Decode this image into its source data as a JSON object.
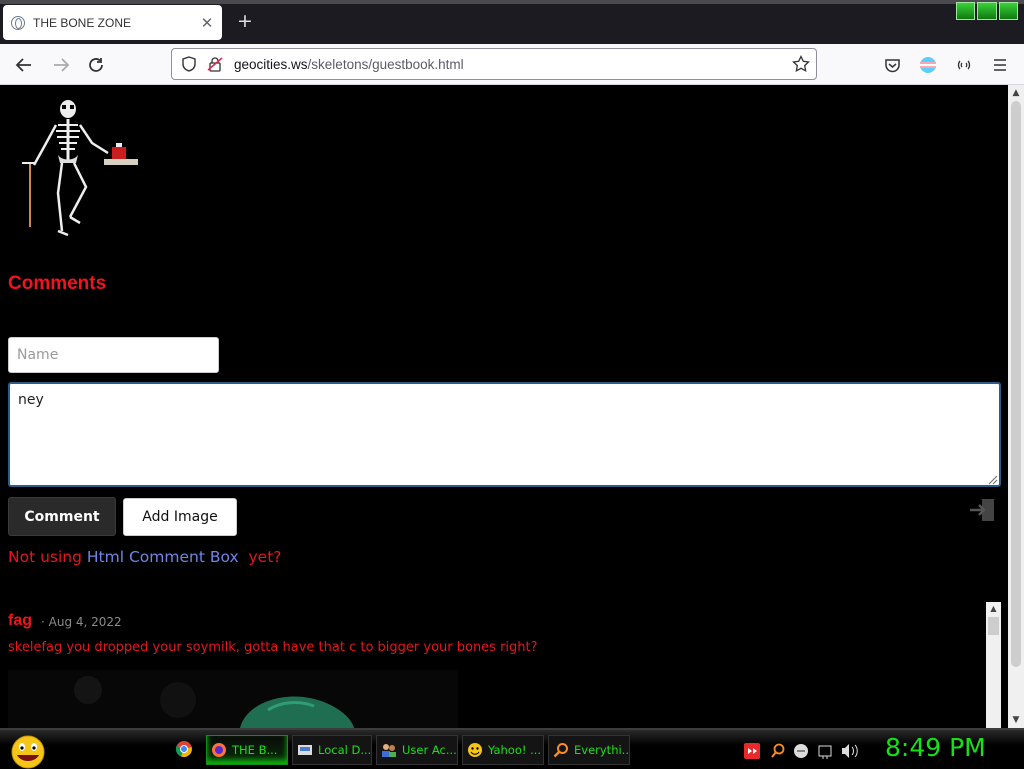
{
  "browser": {
    "tab_title": "THE BONE ZONE",
    "new_tab_label": "+",
    "url_host": "geocities.ws",
    "url_path": "/skeletons/guestbook.html"
  },
  "page": {
    "comments_heading": "Comments",
    "name_placeholder": "Name",
    "comment_value": "ney",
    "comment_button": "Comment",
    "add_image_button": "Add Image",
    "promo_prefix": "Not using ",
    "promo_link": "Html Comment Box",
    "promo_suffix": "  yet?",
    "entry": {
      "author": "fag",
      "date": " · Aug 4, 2022",
      "text": "skelefag you dropped your soymilk, gotta have that c to bigger your bones right?"
    }
  },
  "taskbar": {
    "items": [
      {
        "label": "THE B...",
        "icon": "firefox-icon",
        "active": true
      },
      {
        "label": "Local D...",
        "icon": "drive-icon",
        "active": false
      },
      {
        "label": "User Ac...",
        "icon": "users-icon",
        "active": false
      },
      {
        "label": "Yahoo! ...",
        "icon": "yahoo-icon",
        "active": false
      },
      {
        "label": "Everythi...",
        "icon": "magnifier-icon",
        "active": false
      }
    ],
    "clock": "8:49 PM"
  },
  "colors": {
    "heading_red": "#f0141e",
    "link_blue": "#6f86e6",
    "taskbar_green": "#18e018"
  }
}
